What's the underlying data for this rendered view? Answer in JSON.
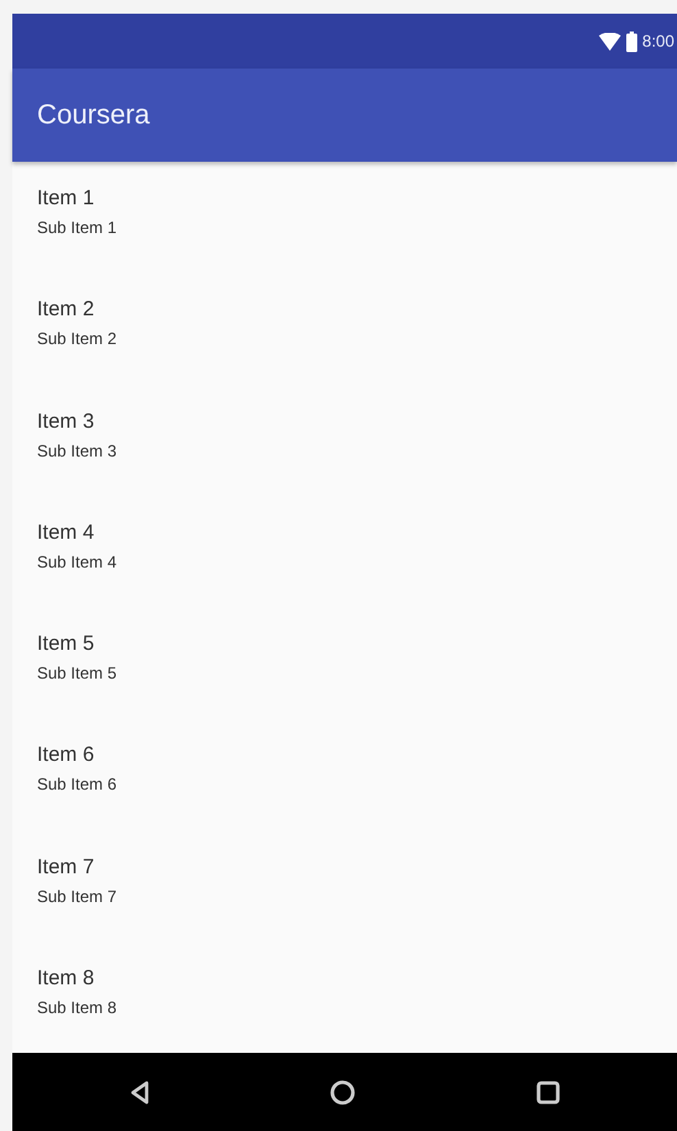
{
  "status_bar": {
    "time": "8:00"
  },
  "app_bar": {
    "title": "Coursera"
  },
  "list": [
    {
      "title": "Item 1",
      "subtitle": "Sub Item 1"
    },
    {
      "title": "Item 2",
      "subtitle": "Sub Item 2"
    },
    {
      "title": "Item 3",
      "subtitle": "Sub Item 3"
    },
    {
      "title": "Item 4",
      "subtitle": "Sub Item 4"
    },
    {
      "title": "Item 5",
      "subtitle": "Sub Item 5"
    },
    {
      "title": "Item 6",
      "subtitle": "Sub Item 6"
    },
    {
      "title": "Item 7",
      "subtitle": "Sub Item 7"
    },
    {
      "title": "Item 8",
      "subtitle": "Sub Item 8"
    }
  ]
}
